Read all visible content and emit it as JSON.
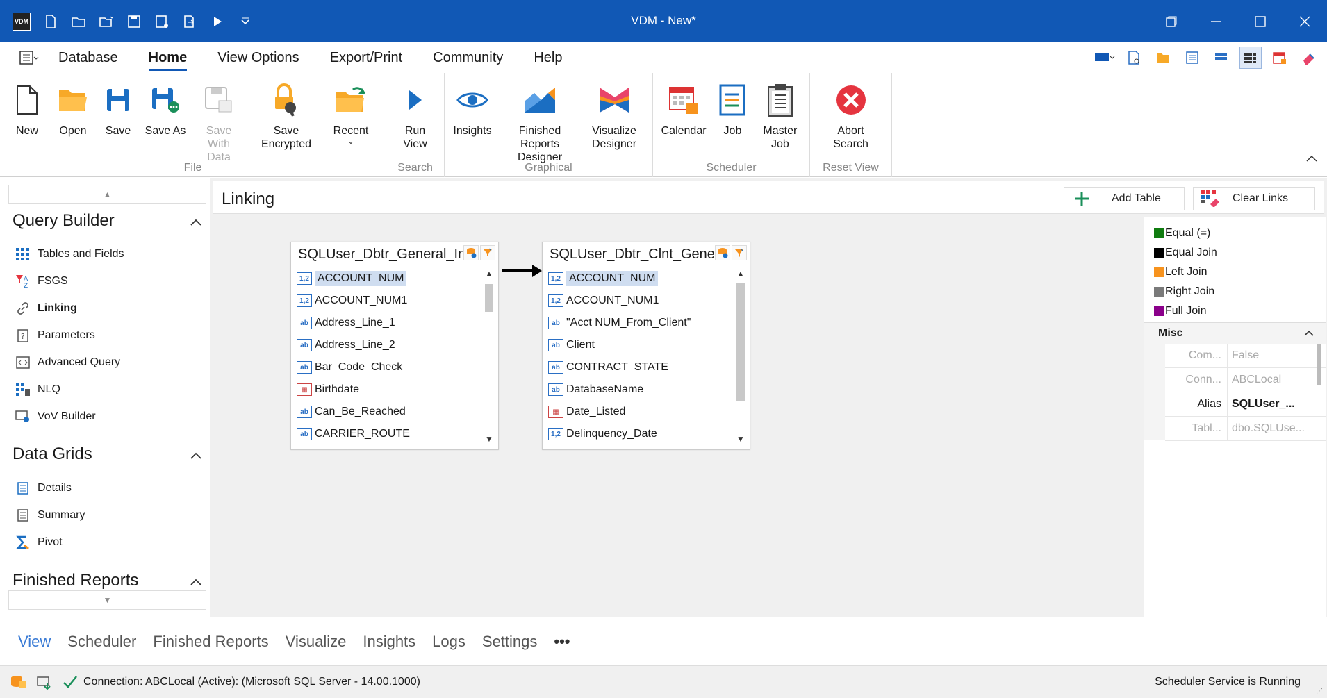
{
  "window": {
    "title": "VDM - New*",
    "app_icon_text": "VDM"
  },
  "menu": {
    "tabs": [
      {
        "label": "Database"
      },
      {
        "label": "Home"
      },
      {
        "label": "View Options"
      },
      {
        "label": "Export/Print"
      },
      {
        "label": "Community"
      },
      {
        "label": "Help"
      }
    ],
    "active": "Home"
  },
  "ribbon": {
    "file": {
      "label": "File",
      "new": "New",
      "open": "Open",
      "save": "Save",
      "save_as": "Save As",
      "save_with_data": "Save With Data",
      "save_encrypted": "Save Encrypted",
      "recent": "Recent"
    },
    "search": {
      "label": "Search",
      "run_view": "Run View"
    },
    "graphical": {
      "label": "Graphical",
      "insights": "Insights",
      "finished_reports_designer": "Finished Reports Designer",
      "visualize_designer": "Visualize Designer"
    },
    "scheduler": {
      "label": "Scheduler",
      "calendar": "Calendar",
      "job": "Job",
      "master_job": "Master Job"
    },
    "reset_view": {
      "label": "Reset View",
      "abort_search": "Abort Search"
    }
  },
  "left_panel": {
    "query_builder": {
      "title": "Query Builder",
      "items": [
        {
          "label": "Tables and Fields"
        },
        {
          "label": "FSGS"
        },
        {
          "label": "Linking"
        },
        {
          "label": "Parameters"
        },
        {
          "label": "Advanced Query"
        },
        {
          "label": "NLQ"
        },
        {
          "label": "VoV Builder"
        }
      ]
    },
    "data_grids": {
      "title": "Data Grids",
      "items": [
        {
          "label": "Details"
        },
        {
          "label": "Summary"
        },
        {
          "label": "Pivot"
        }
      ]
    },
    "finished_reports": {
      "title": "Finished Reports"
    }
  },
  "main": {
    "title": "Linking",
    "add_table": "Add Table",
    "clear_links": "Clear Links",
    "tables": [
      {
        "title": "SQLUser_Dbtr_General_In",
        "fields": [
          {
            "type": "1,2",
            "name": "ACCOUNT_NUM"
          },
          {
            "type": "1,2",
            "name": "ACCOUNT_NUM1"
          },
          {
            "type": "ab",
            "name": "Address_Line_1"
          },
          {
            "type": "ab",
            "name": "Address_Line_2"
          },
          {
            "type": "ab",
            "name": "Bar_Code_Check"
          },
          {
            "type": "date",
            "name": "Birthdate"
          },
          {
            "type": "ab",
            "name": "Can_Be_Reached"
          },
          {
            "type": "ab",
            "name": "CARRIER_ROUTE"
          }
        ]
      },
      {
        "title": "SQLUser_Dbtr_Clnt_Gener",
        "fields": [
          {
            "type": "1,2",
            "name": "ACCOUNT_NUM"
          },
          {
            "type": "1,2",
            "name": "ACCOUNT_NUM1"
          },
          {
            "type": "ab",
            "name": "\"Acct NUM_From_Client\""
          },
          {
            "type": "ab",
            "name": "Client"
          },
          {
            "type": "ab",
            "name": "CONTRACT_STATE"
          },
          {
            "type": "ab",
            "name": "DatabaseName"
          },
          {
            "type": "date",
            "name": "Date_Listed"
          },
          {
            "type": "1,2",
            "name": "Delinquency_Date"
          }
        ]
      }
    ]
  },
  "legend": [
    {
      "label": "Equal (=)",
      "color": "#107c10"
    },
    {
      "label": "Equal Join",
      "color": "#000000"
    },
    {
      "label": "Left Join",
      "color": "#f7931e"
    },
    {
      "label": "Right Join",
      "color": "#7a7a7a"
    },
    {
      "label": "Full Join",
      "color": "#8b008b"
    }
  ],
  "properties": {
    "section": "Misc",
    "rows": [
      {
        "key": "Com...",
        "value": "False"
      },
      {
        "key": "Conn...",
        "value": "ABCLocal"
      },
      {
        "key": "Alias",
        "value": "SQLUser_..."
      },
      {
        "key": "Tabl...",
        "value": "dbo.SQLUse..."
      }
    ]
  },
  "bottom_tabs": [
    {
      "label": "View"
    },
    {
      "label": "Scheduler"
    },
    {
      "label": "Finished Reports"
    },
    {
      "label": "Visualize"
    },
    {
      "label": "Insights"
    },
    {
      "label": "Logs"
    },
    {
      "label": "Settings"
    },
    {
      "label": "•••"
    }
  ],
  "status": {
    "connection": "Connection: ABCLocal (Active): (Microsoft SQL Server - 14.00.1000)",
    "scheduler": "Scheduler Service is Running"
  }
}
